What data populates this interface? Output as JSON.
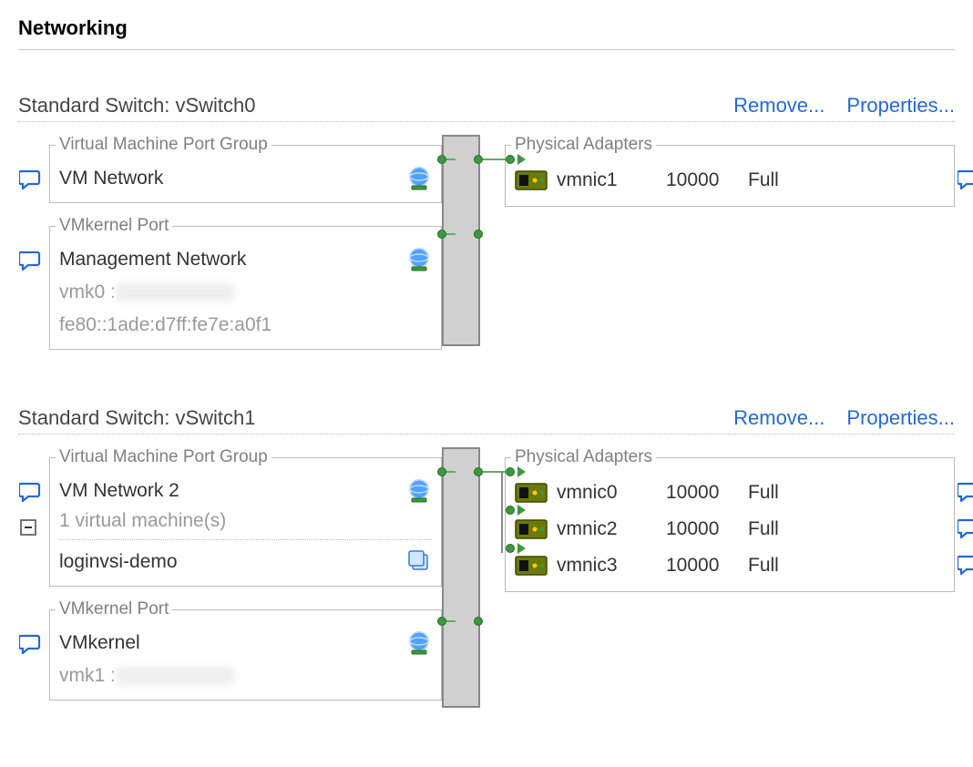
{
  "page_title": "Networking",
  "actions": {
    "remove": "Remove...",
    "properties": "Properties..."
  },
  "labels": {
    "standard_switch_prefix": "Standard Switch: ",
    "vm_port_group": "Virtual Machine Port Group",
    "vmk_port": "VMkernel Port",
    "phys_adapters": "Physical Adapters"
  },
  "switches": [
    {
      "name": "vSwitch0",
      "port_groups": [
        {
          "kind": "vm",
          "title": "VM Network"
        }
      ],
      "vmkernel": {
        "title": "Management Network",
        "vmk_line": "vmk0 : ",
        "ipv6": "fe80::1ade:d7ff:fe7e:a0f1"
      },
      "physical": [
        {
          "name": "vmnic1",
          "speed": "10000",
          "duplex": "Full"
        }
      ]
    },
    {
      "name": "vSwitch1",
      "port_groups": [
        {
          "kind": "vm",
          "title": "VM Network 2",
          "vm_count_line": "1 virtual machine(s)",
          "vms": [
            "loginvsi-demo"
          ]
        }
      ],
      "vmkernel": {
        "title": "VMkernel",
        "vmk_line": "vmk1 : "
      },
      "physical": [
        {
          "name": "vmnic0",
          "speed": "10000",
          "duplex": "Full"
        },
        {
          "name": "vmnic2",
          "speed": "10000",
          "duplex": "Full"
        },
        {
          "name": "vmnic3",
          "speed": "10000",
          "duplex": "Full"
        }
      ]
    }
  ]
}
